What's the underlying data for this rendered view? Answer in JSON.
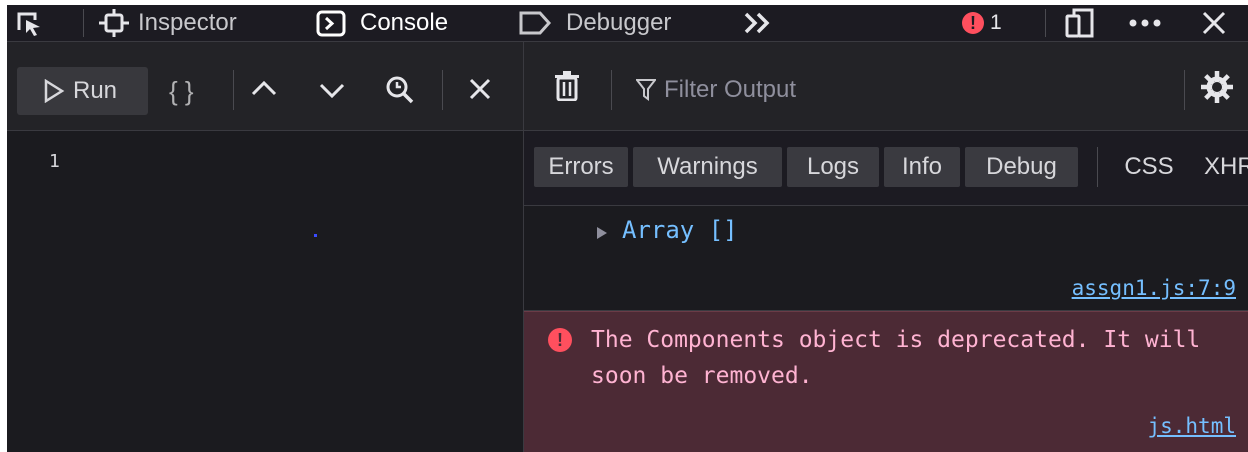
{
  "tabs": {
    "inspector": "Inspector",
    "console": "Console",
    "debugger": "Debugger"
  },
  "error_count": "1",
  "editor": {
    "run_label": "Run",
    "braces_label": "{ }",
    "line_number": "1"
  },
  "console": {
    "filter_placeholder": "Filter Output",
    "filters": [
      "Errors",
      "Warnings",
      "Logs",
      "Info",
      "Debug",
      "CSS",
      "XHR"
    ]
  },
  "messages": {
    "log_text": "Array []",
    "log_source": "assgn1.js:7:9",
    "error_text": "The Components object is deprecated. It will soon be removed.",
    "error_source": "js.html"
  },
  "colors": {
    "background": "#1b1b1f",
    "link": "#75bfff",
    "error_bg": "#4c2a35",
    "error_text": "#ffb3d2",
    "error_badge": "#ff4f5e"
  }
}
